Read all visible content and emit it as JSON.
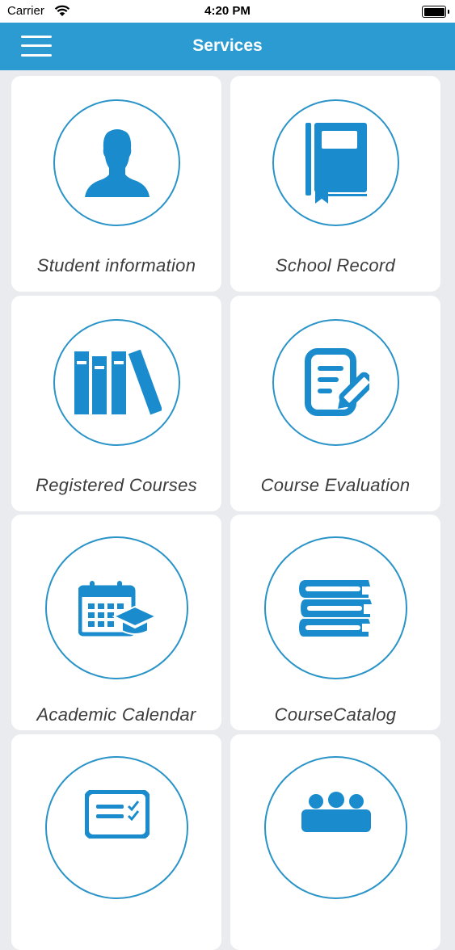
{
  "status_bar": {
    "carrier": "Carrier",
    "time": "4:20 PM"
  },
  "nav": {
    "title": "Services"
  },
  "colors": {
    "accent": "#2b9bd1",
    "icon": "#1a8ccd",
    "circle": "#2a94c8"
  },
  "services": [
    {
      "label": "Student information",
      "icon": "person-icon"
    },
    {
      "label": "School Record",
      "icon": "book-icon"
    },
    {
      "label": "Registered Courses",
      "icon": "books-icon"
    },
    {
      "label": "Course Evaluation",
      "icon": "edit-document-icon"
    },
    {
      "label": "Academic Calendar",
      "icon": "calendar-graduation-icon"
    },
    {
      "label": "CourseCatalog",
      "icon": "book-stack-icon"
    },
    {
      "label": "",
      "icon": "checklist-icon"
    },
    {
      "label": "",
      "icon": "group-icon"
    }
  ]
}
